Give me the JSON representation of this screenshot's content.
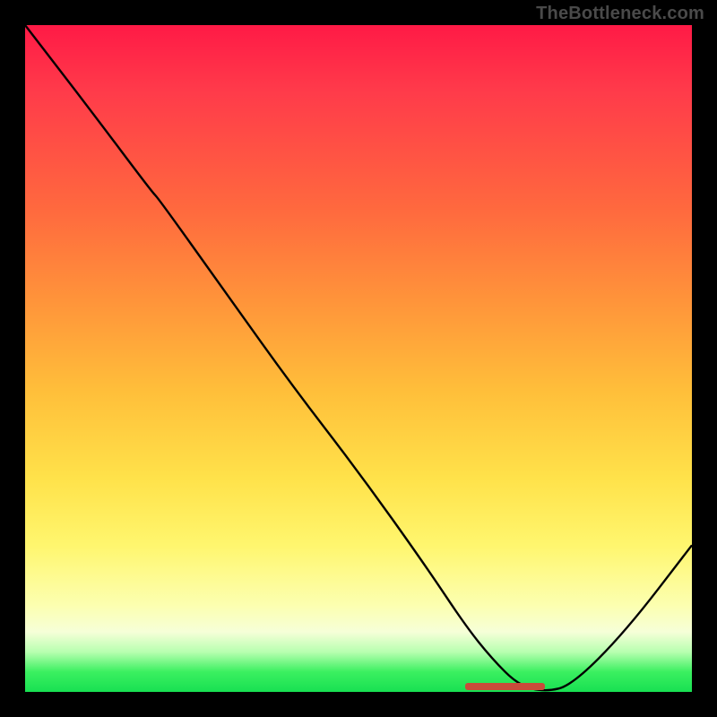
{
  "watermark": "TheBottleneck.com",
  "colors": {
    "page_bg": "#000000",
    "watermark": "#4a4a4a",
    "curve": "#000000",
    "marker": "#c94b3a",
    "gradient_top": "#ff1a46",
    "gradient_bottom": "#18e052"
  },
  "chart_data": {
    "type": "line",
    "title": "",
    "xlabel": "",
    "ylabel": "",
    "xlim": [
      0,
      100
    ],
    "ylim": [
      0,
      100
    ],
    "x": [
      0,
      10,
      19,
      20,
      30,
      40,
      50,
      60,
      66,
      70,
      74,
      78,
      82,
      90,
      100
    ],
    "values": [
      100,
      87,
      75,
      74,
      60,
      46,
      33,
      19,
      10,
      5,
      1,
      0,
      1,
      9,
      22
    ],
    "optimum_x_range": [
      66,
      78
    ],
    "annotations": []
  }
}
